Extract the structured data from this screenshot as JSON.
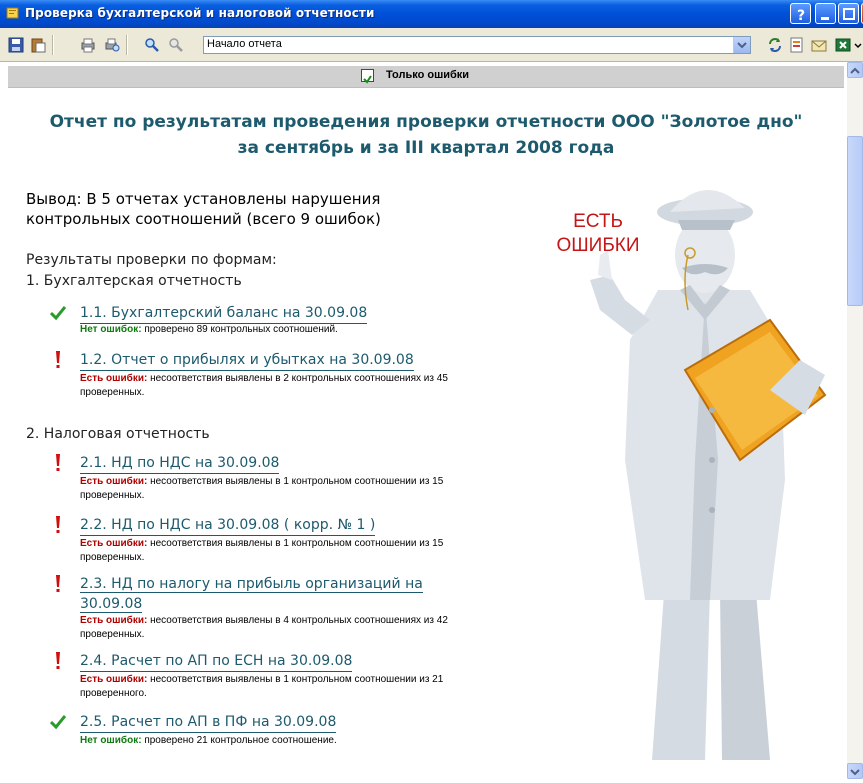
{
  "window": {
    "title": "Проверка бухгалтерской и налоговой отчетности"
  },
  "toolbar": {
    "combo_value": "Начало отчета"
  },
  "filter": {
    "label": "Только ошибки",
    "checked": true
  },
  "report": {
    "title_line1": "Отчет по результатам проведения проверки отчетности ООО \"Золотое дно\"",
    "title_line2": "за сентябрь и за III квартал 2008 года",
    "conclusion": "Вывод: В 5 отчетах установлены нарушения контрольных соотношений (всего 9 ошибок)",
    "results_heading": "Результаты проверки по формам:",
    "section1": "1. Бухгалтерская отчетность",
    "section2": "2. Налоговая отчетность",
    "stamp_line1": "ЕСТЬ",
    "stamp_line2": "ОШИБКИ",
    "ok_label": "Нет ошибок:",
    "err_label": "Есть ошибки:",
    "items": [
      {
        "status": "ok",
        "title": "1.1. Бухгалтерский баланс на 30.09.08",
        "note": "проверено 89 контрольных соотношений."
      },
      {
        "status": "error",
        "title": "1.2. Отчет о прибылях и убытках на 30.09.08",
        "note": "несоответствия выявлены в 2 контрольных соотношениях из 45 проверенных."
      },
      {
        "status": "error",
        "title": "2.1. НД по НДС на 30.09.08",
        "note": "несоответствия выявлены в 1 контрольном соотношении из 15 проверенных."
      },
      {
        "status": "error",
        "title": "2.2. НД по НДС на 30.09.08 ( корр. № 1 )",
        "note": "несоответствия выявлены в 1 контрольном соотношении из 15 проверенных."
      },
      {
        "status": "error",
        "title": "2.3. НД по налогу на прибыль организаций на 30.09.08",
        "note": "несоответствия выявлены в 4 контрольных соотношениях из 42 проверенных."
      },
      {
        "status": "error",
        "title": "2.4. Расчет по АП по ЕСН на 30.09.08",
        "note": "несоответствия выявлены в 1 контрольном соотношении из 21 проверенного."
      },
      {
        "status": "ok",
        "title": "2.5. Расчет по АП в ПФ на 30.09.08",
        "note": "проверено 21 контрольное соотношение."
      }
    ]
  },
  "colors": {
    "title_teal": "#1d5a6d",
    "ok_green": "#0f7b10",
    "error_red": "#b00000",
    "stamp_red": "#c41616"
  }
}
